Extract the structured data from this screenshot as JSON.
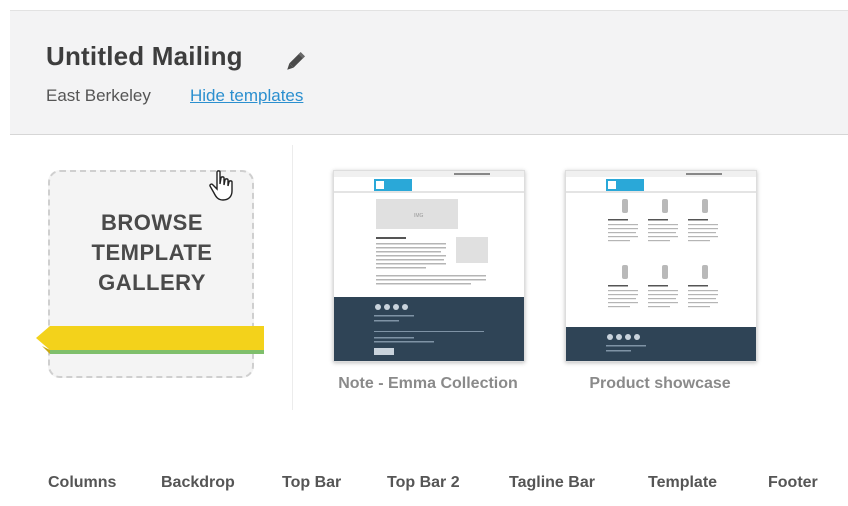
{
  "header": {
    "title": "Untitled Mailing",
    "subtitle": "East Berkeley",
    "hide_templates_link": "Hide templates"
  },
  "browse_card": {
    "label": "BROWSE TEMPLATE GALLERY",
    "ribbon_color": "#f3d21b",
    "ribbon_accent": "#7fbf6b"
  },
  "templates": [
    {
      "name": "Note - Emma Collection",
      "footer_color": "#2f4456",
      "logo_color": "#2aa8d8"
    },
    {
      "name": "Product showcase",
      "footer_color": "#2f4456",
      "logo_color": "#2aa8d8"
    }
  ],
  "bottom_tabs": [
    "Columns",
    "Backdrop",
    "Top Bar",
    "Top Bar 2",
    "Tagline Bar",
    "Template",
    "Footer"
  ]
}
